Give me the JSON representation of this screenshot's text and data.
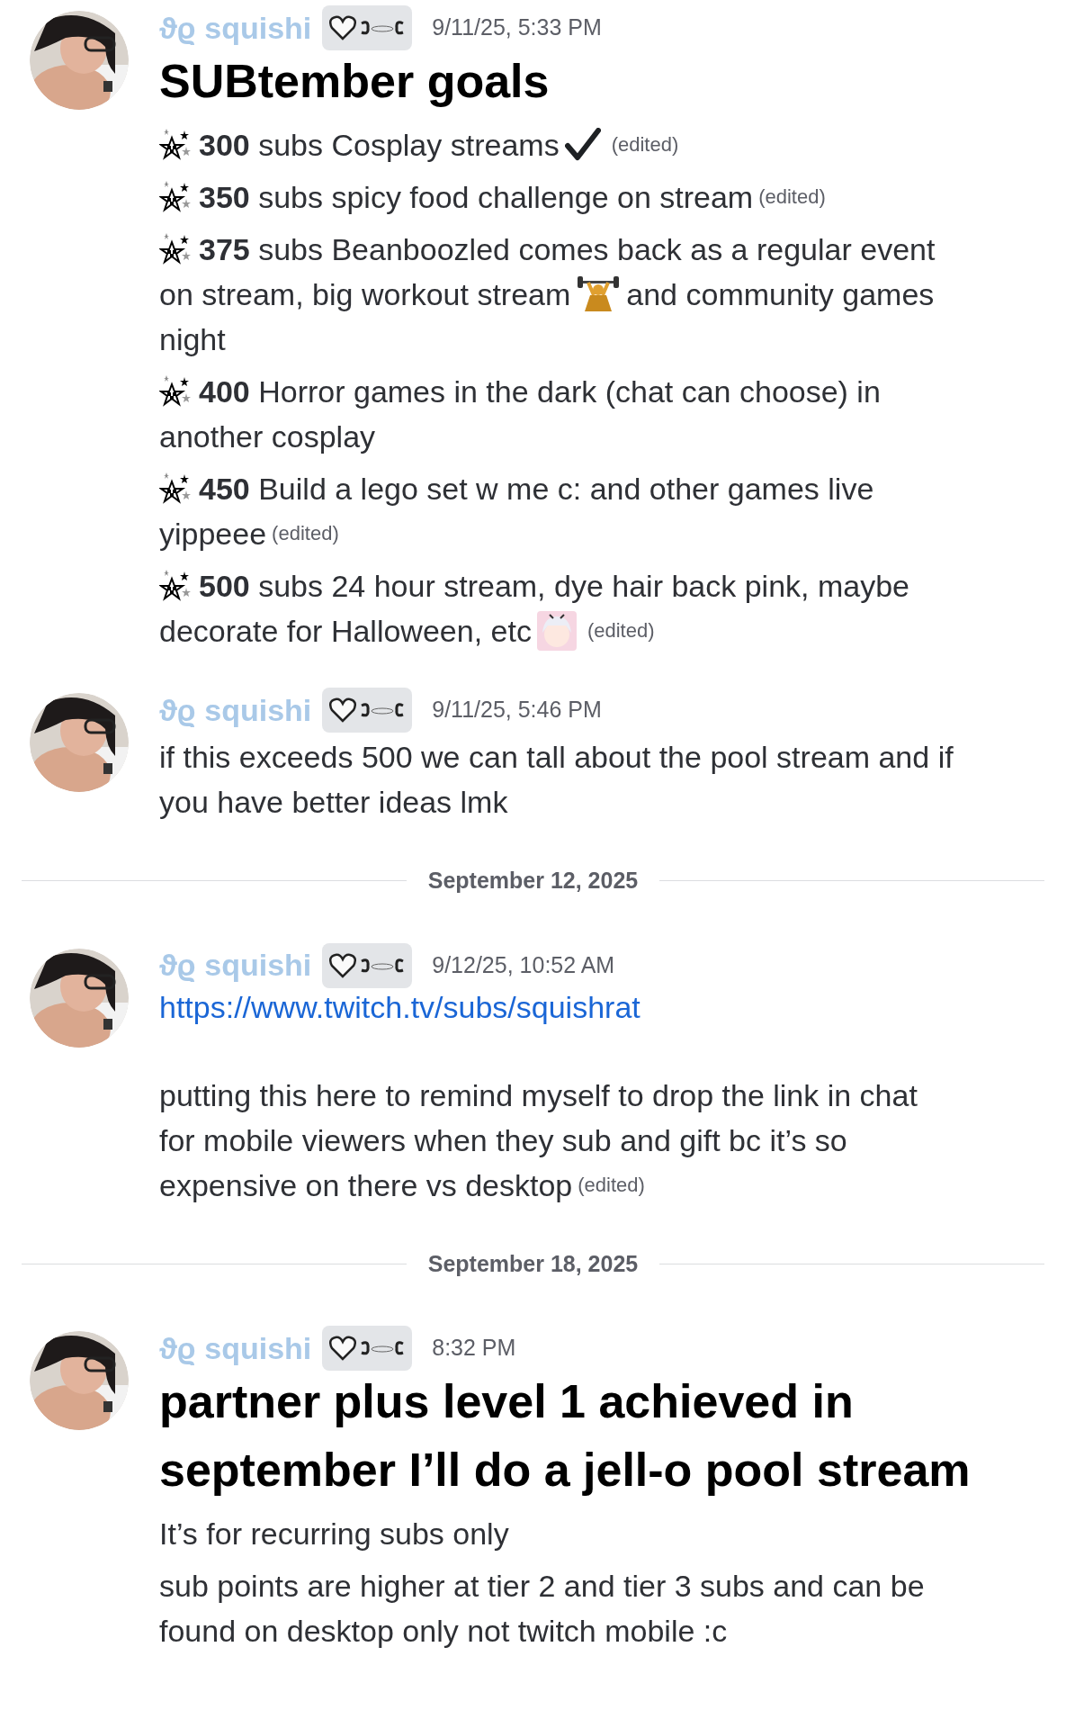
{
  "feed": [
    {
      "kind": "message",
      "author": "ϑϱ squishi",
      "time": "9/11/25, 5:33 PM",
      "blocks": [
        {
          "kind": "heading",
          "text": "SUBtember goals"
        },
        {
          "kind": "goal",
          "lines": [
            [
              {
                "kind": "stars"
              },
              {
                "kind": "text",
                "text": "**300** subs Cosplay streams"
              },
              {
                "kind": "check"
              }
            ]
          ],
          "edited": "(edited)"
        },
        {
          "kind": "goal",
          "lines": [
            [
              {
                "kind": "stars"
              },
              {
                "kind": "text",
                "text": "**350** subs spicy food challenge on stream"
              }
            ]
          ],
          "edited": "(edited)"
        },
        {
          "kind": "goal",
          "lines": [
            [
              {
                "kind": "stars"
              },
              {
                "kind": "text",
                "text": "**375** subs Beanboozled comes back as a regular event"
              }
            ],
            [
              {
                "kind": "text",
                "text": "on stream, big workout stream"
              },
              {
                "kind": "lifter"
              },
              {
                "kind": "text",
                "text": "and community games"
              }
            ],
            [
              {
                "kind": "text",
                "text": "night"
              }
            ]
          ]
        },
        {
          "kind": "goal",
          "lines": [
            [
              {
                "kind": "stars"
              },
              {
                "kind": "text",
                "text": "**400** Horror games in the dark (chat can choose) in"
              }
            ],
            [
              {
                "kind": "text",
                "text": "another cosplay"
              }
            ]
          ]
        },
        {
          "kind": "goal",
          "lines": [
            [
              {
                "kind": "stars"
              },
              {
                "kind": "text",
                "text": "**450** Build a lego set w me c: and other games live"
              }
            ],
            [
              {
                "kind": "text",
                "text": "yippeee"
              }
            ]
          ],
          "edited": "(edited)"
        },
        {
          "kind": "goal",
          "lines": [
            [
              {
                "kind": "stars"
              },
              {
                "kind": "text",
                "text": "**500** subs 24 hour stream, dye hair back pink, maybe"
              }
            ],
            [
              {
                "kind": "text",
                "text": "decorate for Halloween, etc"
              },
              {
                "kind": "sticker"
              }
            ]
          ],
          "edited": "(edited)"
        }
      ]
    },
    {
      "kind": "message",
      "author": "ϑϱ squishi",
      "time": "9/11/25, 5:46 PM",
      "blocks": [
        {
          "kind": "paragraph",
          "lines": [
            "if this exceeds 500 we can tall about the pool stream and if",
            "you have better ideas lmk"
          ]
        }
      ]
    },
    {
      "kind": "divider",
      "text": "September 12, 2025"
    },
    {
      "kind": "message",
      "author": "ϑϱ squishi",
      "time": "9/12/25, 10:52 AM",
      "blocks": [
        {
          "kind": "link",
          "text": "https://www.twitch.tv/subs/squishrat"
        },
        {
          "kind": "paragraph",
          "lines": [
            "putting this here to remind myself to drop the link in chat",
            "for mobile viewers when they sub and gift bc it’s so",
            "expensive on there vs desktop"
          ],
          "edited": "(edited)"
        }
      ]
    },
    {
      "kind": "divider",
      "text": "September 18, 2025"
    },
    {
      "kind": "message",
      "author": "ϑϱ squishi",
      "time": "8:32 PM",
      "blocks": [
        {
          "kind": "heading",
          "text": "partner plus level 1 achieved in september I’ll do a jell-o pool stream"
        },
        {
          "kind": "paragraph",
          "lines": [
            "It’s for recurring subs only"
          ]
        },
        {
          "kind": "paragraph",
          "lines": [
            "sub points are higher at tier 2 and tier 3 subs and can be",
            "found on desktop only not twitch mobile :c"
          ]
        }
      ]
    }
  ]
}
